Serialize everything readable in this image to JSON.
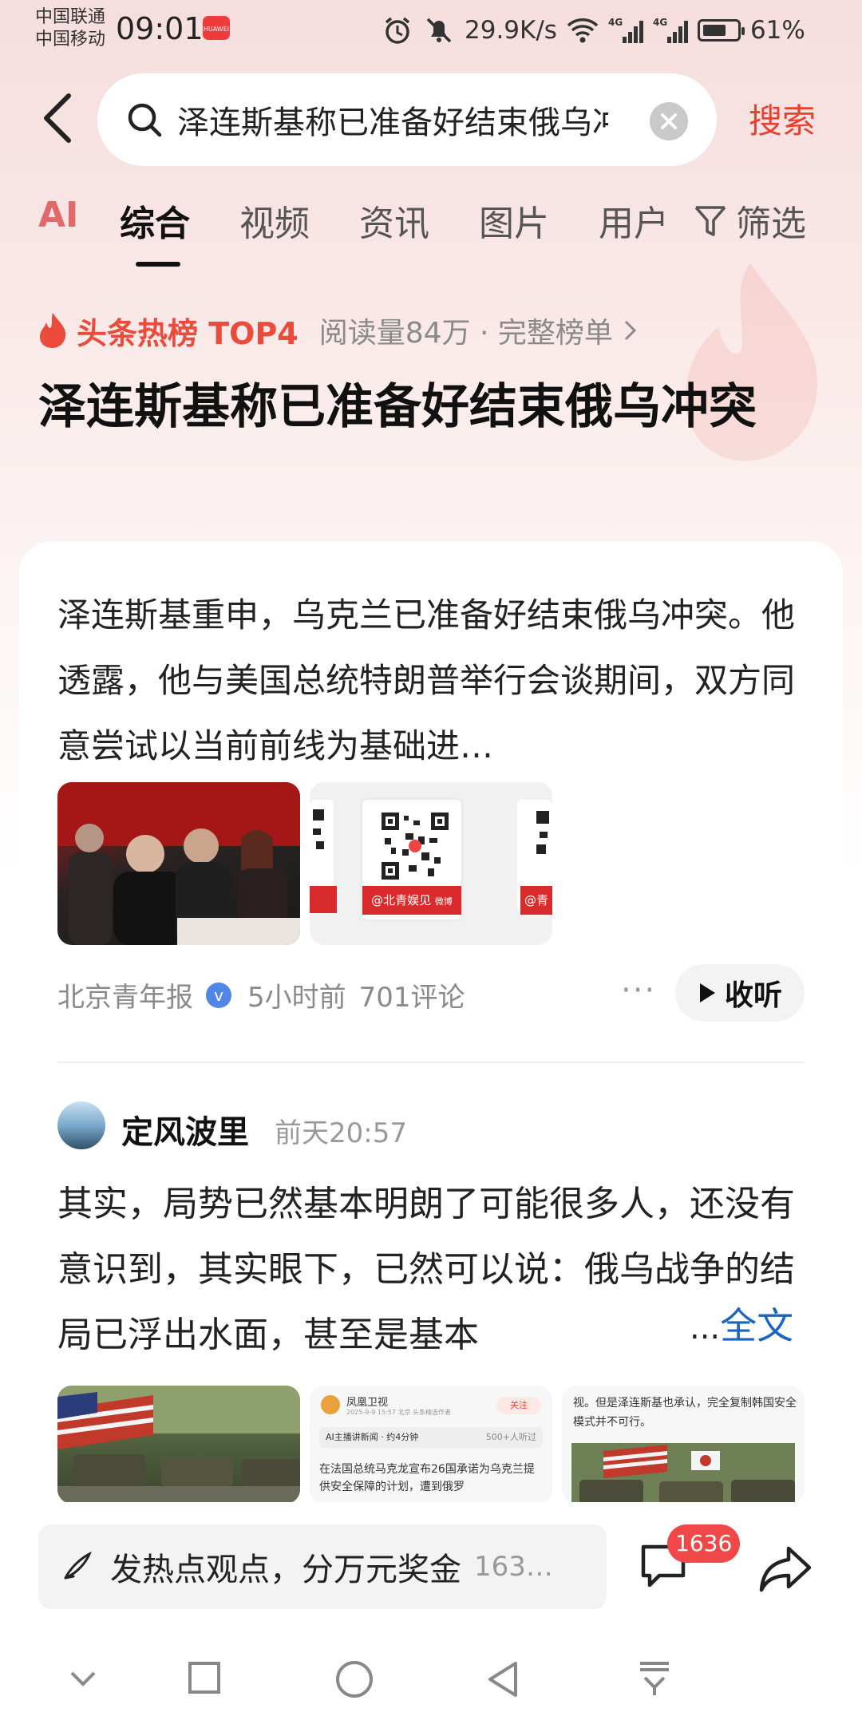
{
  "status_bar": {
    "carrier1": "中国联通",
    "carrier2": "中国移动",
    "time": "09:01",
    "huawei_label": "HUAWEI",
    "network_speed": "29.9K/s",
    "battery": "61%",
    "signal_label": "4G"
  },
  "search": {
    "query": "泽连斯基称已准备好结束俄乌冲突",
    "button": "搜索"
  },
  "tabs": {
    "ai": "AI",
    "items": [
      "综合",
      "视频",
      "资讯",
      "图片",
      "用户"
    ],
    "filter": "筛选"
  },
  "hot": {
    "label": "头条热榜 TOP4",
    "meta": "阅读量84万 · 完整榜单"
  },
  "headline": "泽连斯基称已准备好结束俄乌冲突",
  "article": {
    "summary": "泽连斯基重申，乌克兰已准备好结束俄乌冲突。他透露，他与美国总统特朗普举行会谈期间，双方同意尝试以当前前线为基础进…",
    "qr_caption": "@北青娱见",
    "qr_caption_side": "@青",
    "weibo_label": "微博",
    "source": "北京青年报",
    "verified": "v",
    "time": "5小时前",
    "comments": "701评论",
    "more": "···",
    "listen": "收听"
  },
  "post": {
    "author": "定风波里",
    "time": "前天20:57",
    "text": "其实，局势已然基本明朗了可能很多人，还没有意识到，其实眼下，已然可以说：俄乌战争的结局已浮出水面，甚至是基本",
    "ellipsis": "...",
    "full_text": "全文",
    "preview2_channel": "凤凰卫视",
    "preview2_follow": "关注",
    "preview2_meta": "2025-9-9 15:57 北京 头条精选作者",
    "preview2_audio": "AI主播讲新闻 · 约4分钟",
    "preview2_listeners": "500+人听过",
    "preview2_text": "在法国总统马克龙宣布26国承诺为乌克兰提供安全保障的计划，遭到俄罗",
    "preview3_text": "视。但是泽连斯基也承认，完全复制韩国安全模式并不可行。"
  },
  "bottom": {
    "input_text": "发热点观点，分万元奖金",
    "input_count": "163…",
    "badge": "1636"
  },
  "colors": {
    "accent": "#e8402f",
    "link": "#1a64c6",
    "badge": "#f04848"
  }
}
